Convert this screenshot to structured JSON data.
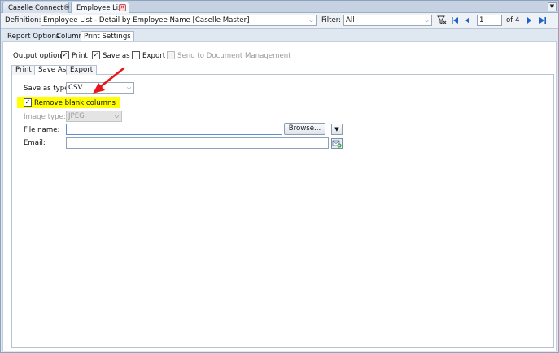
{
  "doc_tabs": [
    {
      "label": "Caselle Connect®"
    },
    {
      "label": "Employee List"
    }
  ],
  "toolbar": {
    "definition_label": "Definition:",
    "definition_value": "Employee List - Detail by Employee Name [Caselle Master]",
    "filter_label": "Filter:",
    "filter_value": "All",
    "page_value": "1",
    "page_of": "of 4"
  },
  "report_tabs": [
    {
      "label": "Report Options"
    },
    {
      "label": "Columns"
    },
    {
      "label": "Print Settings"
    }
  ],
  "output_options": {
    "label": "Output options:",
    "print_label": "Print",
    "print_checked": "✓",
    "save_as_label": "Save as",
    "save_as_checked": "✓",
    "export_label": "Export",
    "send_label": "Send to Document Management"
  },
  "inner_tabs": [
    {
      "label": "Print"
    },
    {
      "label": "Save As"
    },
    {
      "label": "Export"
    }
  ],
  "save_as": {
    "type_label": "Save as type:",
    "type_value": "CSV",
    "remove_blank_label": "Remove blank columns",
    "remove_blank_checked": "✓",
    "image_type_label": "Image type:",
    "image_type_value": "JPEG",
    "file_name_label": "File name:",
    "file_name_value": "",
    "browse_label": "Browse...",
    "email_label": "Email:",
    "email_value": ""
  },
  "colors": {
    "highlight": "#ffff00",
    "annotation_arrow": "#e8161b"
  }
}
